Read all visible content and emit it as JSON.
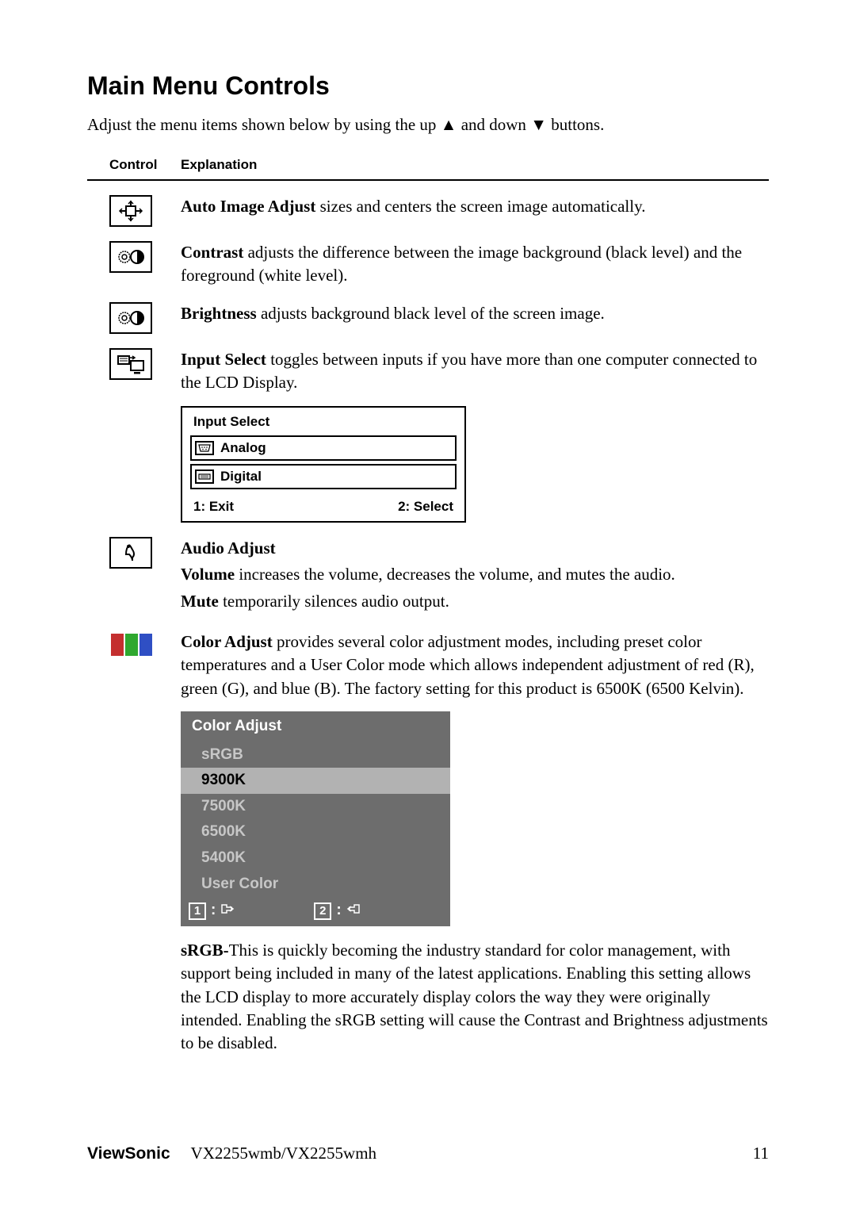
{
  "title": "Main Menu Controls",
  "intro_pre": "Adjust the menu items shown below by using the up ",
  "intro_mid": " and down ",
  "intro_post": " buttons.",
  "tri_up": "▲",
  "tri_down": "▼",
  "table_header": {
    "control": "Control",
    "explanation": "Explanation"
  },
  "rows": {
    "auto": {
      "bold": "Auto Image Adjust",
      "text": " sizes and centers the screen image automatically."
    },
    "contrast": {
      "bold": "Contrast",
      "text": " adjusts the difference between the image background  (black level) and the foreground (white level)."
    },
    "brightness": {
      "bold": "Brightness",
      "text": " adjusts background black level of the screen image."
    },
    "input_select": {
      "bold": "Input Select",
      "text": " toggles between inputs if you have more than one computer connected to the LCD Display."
    },
    "audio": {
      "title": "Audio Adjust",
      "vol_bold": "Volume",
      "vol_text": " increases the volume, decreases the volume, and mutes the audio.",
      "mute_bold": "Mute",
      "mute_text": " temporarily silences audio output."
    },
    "color": {
      "bold": "Color Adjust",
      "text": " provides several color adjustment modes, including preset color temperatures and a User Color mode which allows independent adjustment of red (R), green (G), and blue (B). The factory setting for this product is 6500K (6500 Kelvin)."
    },
    "srgb": {
      "bold": "sRGB-",
      "text": "This is quickly becoming the industry standard for color management, with support being included in many of the latest applications. Enabling this setting allows the LCD display to more accurately display colors the way they were originally intended. Enabling the sRGB setting will cause the Contrast and Brightness adjustments to be disabled."
    }
  },
  "input_select_panel": {
    "title": "Input Select",
    "items": [
      "Analog",
      "Digital"
    ],
    "footer_left": "1: Exit",
    "footer_right": "2: Select"
  },
  "color_adjust_panel": {
    "title": "Color Adjust",
    "items": [
      "sRGB",
      "9300K",
      "7500K",
      "6500K",
      "5400K",
      "User Color"
    ],
    "highlight_index": 1,
    "k1": "1",
    "k2": "2",
    "colon": ":"
  },
  "footer": {
    "brand": "ViewSonic",
    "model": "VX2255wmb/VX2255wmh",
    "page": "11"
  }
}
